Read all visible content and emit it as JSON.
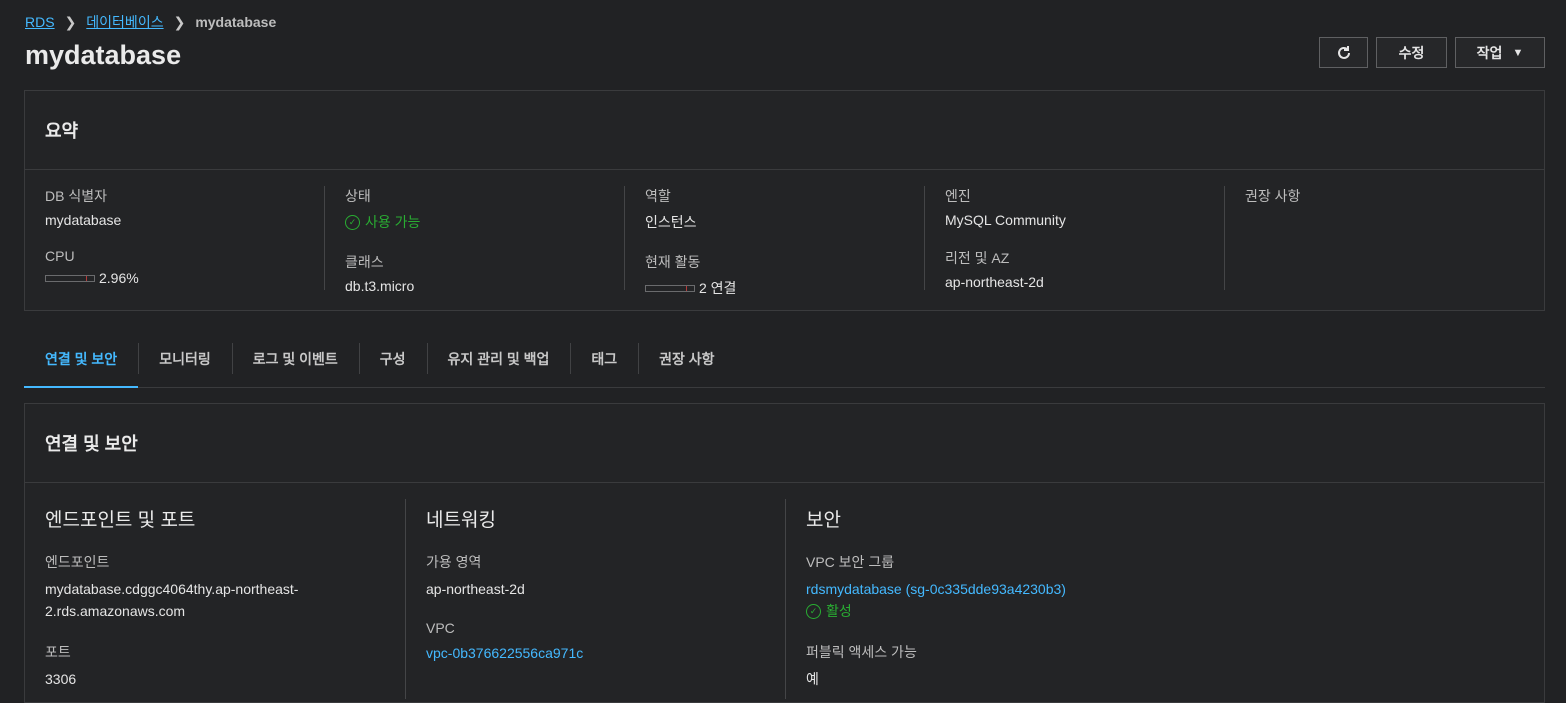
{
  "breadcrumb": {
    "rds": "RDS",
    "databases": "데이터베이스",
    "current": "mydatabase"
  },
  "page_title": "mydatabase",
  "actions": {
    "edit": "수정",
    "actions": "작업"
  },
  "summary": {
    "title": "요약",
    "db_identifier_label": "DB 식별자",
    "db_identifier": "mydatabase",
    "cpu_label": "CPU",
    "cpu_value": "2.96%",
    "cpu_fraction": 0.0296,
    "status_label": "상태",
    "status_value": "사용 가능",
    "class_label": "클래스",
    "class_value": "db.t3.micro",
    "role_label": "역할",
    "role_value": "인스턴스",
    "activity_label": "현재 활동",
    "activity_value": "2 연결",
    "engine_label": "엔진",
    "engine_value": "MySQL Community",
    "region_label": "리전 및 AZ",
    "region_value": "ap-northeast-2d",
    "recommendations_label": "권장 사항"
  },
  "tabs": [
    "연결 및 보안",
    "모니터링",
    "로그 및 이벤트",
    "구성",
    "유지 관리 및 백업",
    "태그",
    "권장 사항"
  ],
  "connectivity": {
    "title": "연결 및 보안",
    "endpoint_heading": "엔드포인트 및 포트",
    "endpoint_label": "엔드포인트",
    "endpoint_value": "mydatabase.cdggc4064thy.ap-northeast-2.rds.amazonaws.com",
    "port_label": "포트",
    "port_value": "3306",
    "network_heading": "네트워킹",
    "az_label": "가용 영역",
    "az_value": "ap-northeast-2d",
    "vpc_label": "VPC",
    "vpc_value": "vpc-0b376622556ca971c",
    "security_heading": "보안",
    "sg_label": "VPC 보안 그룹",
    "sg_value": "rdsmydatabase (sg-0c335dde93a4230b3)",
    "sg_status": "활성",
    "public_label": "퍼블릭 액세스 가능",
    "public_value": "예"
  },
  "colors": {
    "accent": "#44b9ff",
    "success": "#29ad32",
    "background": "#212224"
  },
  "icons": {
    "refresh": "refresh-icon",
    "chevron": "chevron-right-icon",
    "caret": "caret-down-icon",
    "check": "check-circle-icon"
  }
}
